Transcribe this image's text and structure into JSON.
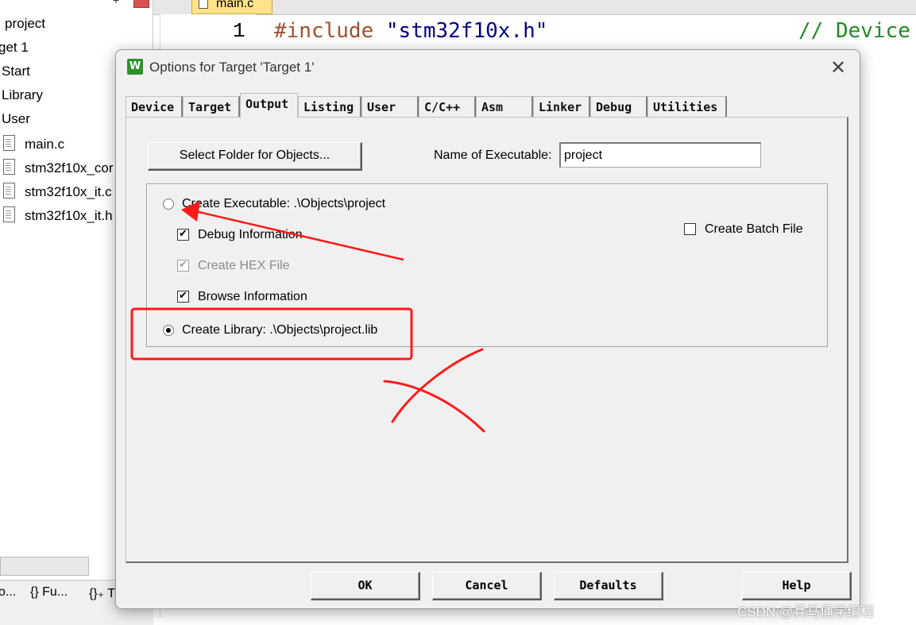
{
  "project_tree": {
    "items": [
      {
        "label": "project"
      },
      {
        "label": "get 1"
      },
      {
        "label": "Start"
      },
      {
        "label": "Library"
      },
      {
        "label": "User"
      }
    ],
    "files": [
      {
        "label": "main.c"
      },
      {
        "label": "stm32f10x_cor"
      },
      {
        "label": "stm32f10x_it.c"
      },
      {
        "label": "stm32f10x_it.h"
      }
    ],
    "bottom_tabs": [
      {
        "label": "o..."
      },
      {
        "label": "{} Fu..."
      },
      {
        "label": "{}₊ T"
      }
    ]
  },
  "editor": {
    "tab_label": "main.c",
    "line_number": "1",
    "code_keyword": "#include",
    "code_string": "\"stm32f10x.h\"",
    "code_comment": "// Device"
  },
  "dialog": {
    "icon_glyph": "W",
    "title": "Options for Target 'Target 1'",
    "close_glyph": "✕",
    "tabs": [
      {
        "label": "Device"
      },
      {
        "label": "Target"
      },
      {
        "label": "Output"
      },
      {
        "label": "Listing"
      },
      {
        "label": "User"
      },
      {
        "label": "C/C++"
      },
      {
        "label": "Asm"
      },
      {
        "label": "Linker"
      },
      {
        "label": "Debug"
      },
      {
        "label": "Utilities"
      }
    ],
    "active_tab": "Output",
    "output": {
      "select_folder_label": "Select Folder for Objects...",
      "name_of_executable_label": "Name of Executable:",
      "name_of_executable_value": "project",
      "create_executable_label": "Create Executable:  .\\Objects\\project",
      "create_executable_checked": false,
      "debug_information_label": "Debug Information",
      "debug_information_checked": true,
      "create_hex_label": "Create HEX File",
      "create_hex_checked": true,
      "create_hex_enabled": false,
      "browse_information_label": "Browse Information",
      "browse_information_checked": true,
      "create_library_label": "Create Library:  .\\Objects\\project.lib",
      "create_library_checked": true,
      "create_batch_label": "Create Batch File",
      "create_batch_checked": false,
      "check_glyph": "✔"
    },
    "footer": {
      "ok": "OK",
      "cancel": "Cancel",
      "defaults": "Defaults",
      "help": "Help"
    }
  },
  "annotations": {
    "color": "#ff1a1a",
    "shapes": [
      "arrow",
      "rectangle-highlight",
      "cross-mark"
    ]
  },
  "watermark": "CSDN @兵马俑学编程"
}
